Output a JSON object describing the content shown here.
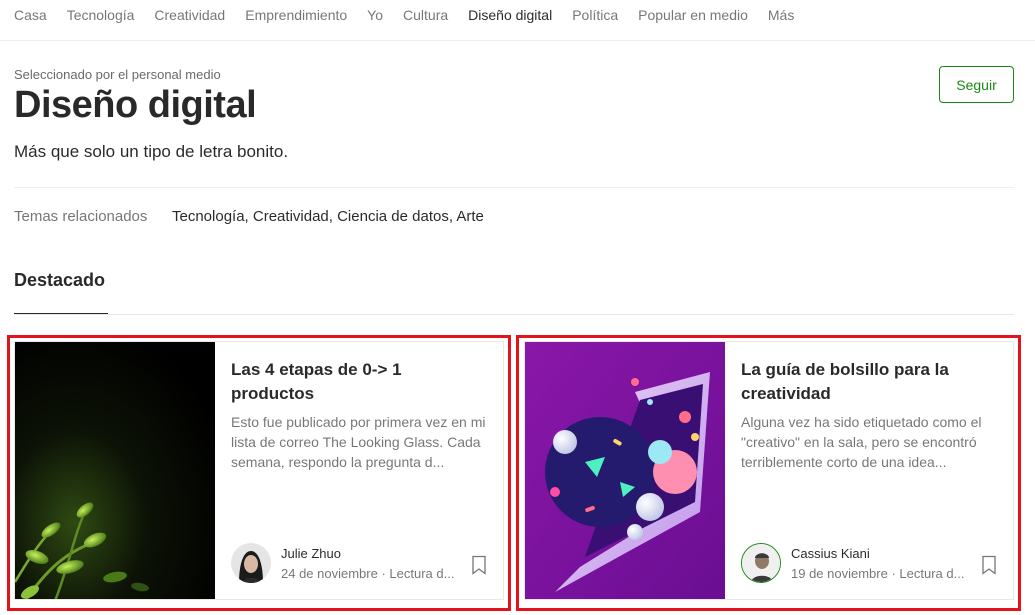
{
  "nav": {
    "items": [
      {
        "label": "Casa"
      },
      {
        "label": "Tecnología"
      },
      {
        "label": "Creatividad"
      },
      {
        "label": "Emprendimiento"
      },
      {
        "label": "Yo"
      },
      {
        "label": "Cultura"
      },
      {
        "label": "Diseño digital"
      },
      {
        "label": "Política"
      },
      {
        "label": "Popular en medio"
      },
      {
        "label": "Más"
      }
    ],
    "active": "Diseño digital"
  },
  "header": {
    "eyebrow": "Seleccionado por el personal medio",
    "title": "Diseño digital",
    "subtitle": "Más que solo un tipo de letra bonito.",
    "follow_label": "Seguir"
  },
  "related": {
    "label": "Temas relacionados",
    "topics": "Tecnología, Creatividad, Ciencia de datos, Arte"
  },
  "featured": {
    "label": "Destacado",
    "cards": [
      {
        "title": "Las 4 etapas de 0-> 1 productos",
        "excerpt": "Esto fue publicado por primera vez en mi lista de correo The Looking Glass. Cada semana, respondo la pregunta d...",
        "author": "Julie Zhuo",
        "meta": "24 de noviembre · Lectura d..."
      },
      {
        "title": "La guía de bolsillo para la creatividad",
        "excerpt": "Alguna vez ha sido etiquetado como el \"creativo\" en la sala, pero se encontró terriblemente corto de una idea...",
        "author": "Cassius Kiani",
        "meta": "19 de noviembre · Lectura d..."
      }
    ]
  },
  "colors": {
    "accent_green": "#1a8917",
    "highlight_red": "#e3131b"
  }
}
